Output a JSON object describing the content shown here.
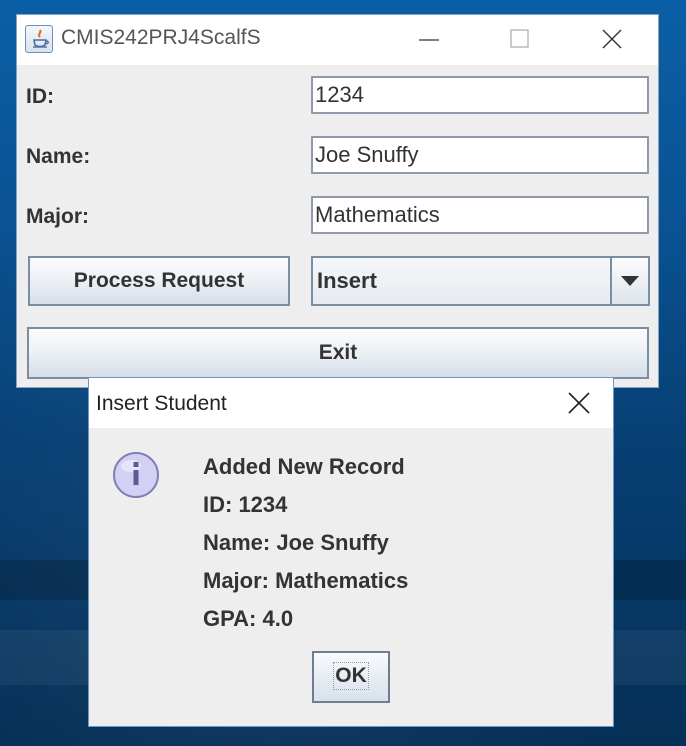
{
  "main_window": {
    "title": "CMIS242PRJ4ScalfS",
    "form": {
      "id_label": "ID:",
      "id_value": "1234",
      "name_label": "Name:",
      "name_value": "Joe Snuffy",
      "major_label": "Major:",
      "major_value": "Mathematics"
    },
    "process_button": "Process Request",
    "action_select": {
      "selected": "Insert"
    },
    "exit_button": "Exit"
  },
  "dialog": {
    "title": "Insert Student",
    "icon": "info-icon",
    "lines": [
      "Added New Record",
      "ID: 1234",
      "Name: Joe Snuffy",
      "Major: Mathematics",
      "GPA: 4.0"
    ],
    "ok_button": "OK"
  },
  "colors": {
    "desktop": "#0a5293",
    "window_bg": "#eeeeee",
    "titlebar": "#ffffff",
    "info_icon_fill": "#c9c8f0"
  }
}
